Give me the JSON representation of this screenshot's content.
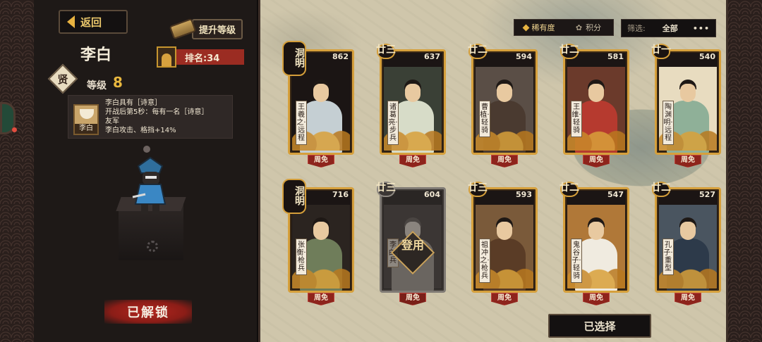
{
  "header": {
    "back_label": "返回",
    "upgrade_label": "提升等级",
    "hero_name": "李白",
    "rank_label": "排名:34",
    "tier_badge": "贤",
    "level_label": "等级",
    "level_value": "8"
  },
  "skill": {
    "icon_caption": "李白",
    "lines": [
      "李白具有［诗意］",
      "开战后第5秒：每有一名［诗意］",
      "友军",
      "李白攻击、格挡+14%"
    ]
  },
  "status": {
    "unlocked_label": "已解锁"
  },
  "filters": {
    "sort_tabs": [
      "稀有度",
      "积分"
    ],
    "filter_label": "筛选:",
    "filter_value": "全部",
    "more": "•••"
  },
  "cards": [
    {
      "tier": "洞明",
      "score": "862",
      "name": "王羲之",
      "role": "远程",
      "weekly": "周免",
      "disabled": false,
      "colors": {
        "robe": "#c5cfd3",
        "bg": "#1b1514"
      }
    },
    {
      "tier": "廿三",
      "score": "637",
      "name": "诸葛亮",
      "role": "步兵",
      "weekly": "周免",
      "disabled": false,
      "colors": {
        "robe": "#d7dcc8",
        "bg": "#3a4036"
      }
    },
    {
      "tier": "廿二",
      "score": "594",
      "name": "曹植",
      "role": "轻骑",
      "weekly": "周免",
      "disabled": false,
      "colors": {
        "robe": "#4a3a30",
        "bg": "#5a4e46"
      }
    },
    {
      "tier": "廿二",
      "score": "581",
      "name": "王维",
      "role": "轻骑",
      "weekly": "周免",
      "disabled": false,
      "colors": {
        "robe": "#b63a2f",
        "bg": "#6b3a2b"
      }
    },
    {
      "tier": "廿一",
      "score": "540",
      "name": "陶渊明",
      "role": "远程",
      "weekly": "周免",
      "disabled": false,
      "colors": {
        "robe": "#8fb098",
        "bg": "#e8dcc0"
      }
    },
    {
      "tier": "洞明",
      "score": "716",
      "name": "张衡",
      "role": "枪兵",
      "weekly": "周免",
      "disabled": false,
      "colors": {
        "robe": "#6f7d5a",
        "bg": "#2b2420"
      }
    },
    {
      "tier": "廿三",
      "score": "604",
      "name": "李白",
      "role": "兵",
      "weekly": "周免",
      "disabled": true,
      "overlay": "登用",
      "colors": {
        "robe": "#6a6560",
        "bg": "#3b3634"
      }
    },
    {
      "tier": "廿三",
      "score": "593",
      "name": "祖冲之",
      "role": "枪兵",
      "weekly": "周免",
      "disabled": false,
      "colors": {
        "robe": "#5a3c26",
        "bg": "#7a5a3a"
      }
    },
    {
      "tier": "廿二",
      "score": "547",
      "name": "鬼谷子",
      "role": "轻骑",
      "weekly": "周免",
      "disabled": false,
      "colors": {
        "robe": "#f0ebe0",
        "bg": "#b07838"
      }
    },
    {
      "tier": "廿二",
      "score": "527",
      "name": "孔子",
      "role": "重型",
      "weekly": "周免",
      "disabled": false,
      "colors": {
        "robe": "#2d3a4a",
        "bg": "#4a5560"
      }
    }
  ],
  "footer": {
    "selected_label": "已选择"
  }
}
